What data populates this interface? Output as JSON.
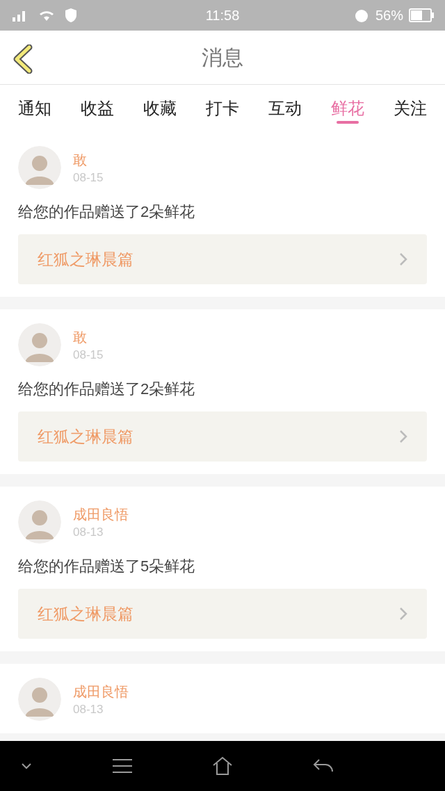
{
  "status_bar": {
    "time": "11:58",
    "battery": "56%"
  },
  "header": {
    "title": "消息"
  },
  "tabs": [
    {
      "label": "通知",
      "selected": false
    },
    {
      "label": "收益",
      "selected": false
    },
    {
      "label": "收藏",
      "selected": false
    },
    {
      "label": "打卡",
      "selected": false
    },
    {
      "label": "互动",
      "selected": false
    },
    {
      "label": "鲜花",
      "selected": true
    },
    {
      "label": "关注",
      "selected": false
    }
  ],
  "messages": [
    {
      "user": "敢",
      "date": "08-15",
      "text": "给您的作品赠送了2朵鲜花",
      "work": "红狐之琳晨篇"
    },
    {
      "user": "敢",
      "date": "08-15",
      "text": "给您的作品赠送了2朵鲜花",
      "work": "红狐之琳晨篇"
    },
    {
      "user": "成田良悟",
      "date": "08-13",
      "text": "给您的作品赠送了5朵鲜花",
      "work": "红狐之琳晨篇"
    },
    {
      "user": "成田良悟",
      "date": "08-13"
    }
  ]
}
